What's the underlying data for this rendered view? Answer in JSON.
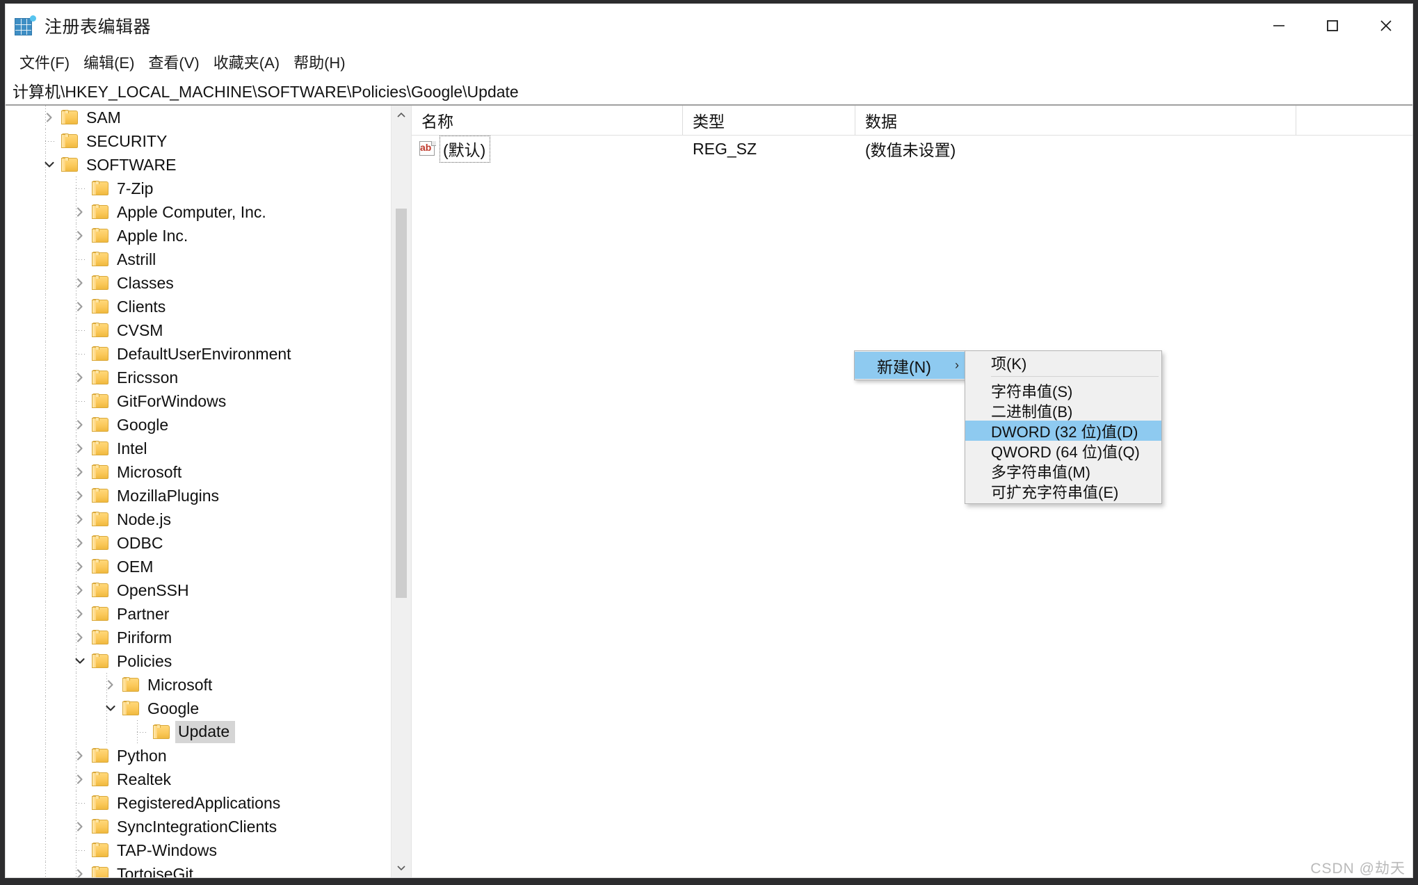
{
  "window": {
    "title": "注册表编辑器",
    "app_icon": "registry-editor-icon",
    "buttons": {
      "minimize": "minimize-icon",
      "maximize": "maximize-icon",
      "close": "close-icon"
    }
  },
  "menu_bar": {
    "items": [
      {
        "label": "文件(F)"
      },
      {
        "label": "编辑(E)"
      },
      {
        "label": "查看(V)"
      },
      {
        "label": "收藏夹(A)"
      },
      {
        "label": "帮助(H)"
      }
    ]
  },
  "address_bar": {
    "path": "计算机\\HKEY_LOCAL_MACHINE\\SOFTWARE\\Policies\\Google\\Update"
  },
  "tree": {
    "items": [
      {
        "label": "SAM",
        "depth": 1,
        "state": "collapsed",
        "selected": false
      },
      {
        "label": "SECURITY",
        "depth": 1,
        "state": "leaf",
        "selected": false
      },
      {
        "label": "SOFTWARE",
        "depth": 1,
        "state": "expanded",
        "selected": false
      },
      {
        "label": "7-Zip",
        "depth": 2,
        "state": "leaf",
        "selected": false
      },
      {
        "label": "Apple Computer, Inc.",
        "depth": 2,
        "state": "collapsed",
        "selected": false
      },
      {
        "label": "Apple Inc.",
        "depth": 2,
        "state": "collapsed",
        "selected": false
      },
      {
        "label": "Astrill",
        "depth": 2,
        "state": "leaf",
        "selected": false
      },
      {
        "label": "Classes",
        "depth": 2,
        "state": "collapsed",
        "selected": false
      },
      {
        "label": "Clients",
        "depth": 2,
        "state": "collapsed",
        "selected": false
      },
      {
        "label": "CVSM",
        "depth": 2,
        "state": "leaf",
        "selected": false
      },
      {
        "label": "DefaultUserEnvironment",
        "depth": 2,
        "state": "leaf",
        "selected": false
      },
      {
        "label": "Ericsson",
        "depth": 2,
        "state": "collapsed",
        "selected": false
      },
      {
        "label": "GitForWindows",
        "depth": 2,
        "state": "leaf",
        "selected": false
      },
      {
        "label": "Google",
        "depth": 2,
        "state": "collapsed",
        "selected": false
      },
      {
        "label": "Intel",
        "depth": 2,
        "state": "collapsed",
        "selected": false
      },
      {
        "label": "Microsoft",
        "depth": 2,
        "state": "collapsed",
        "selected": false
      },
      {
        "label": "MozillaPlugins",
        "depth": 2,
        "state": "collapsed",
        "selected": false
      },
      {
        "label": "Node.js",
        "depth": 2,
        "state": "collapsed",
        "selected": false
      },
      {
        "label": "ODBC",
        "depth": 2,
        "state": "collapsed",
        "selected": false
      },
      {
        "label": "OEM",
        "depth": 2,
        "state": "collapsed",
        "selected": false
      },
      {
        "label": "OpenSSH",
        "depth": 2,
        "state": "collapsed",
        "selected": false
      },
      {
        "label": "Partner",
        "depth": 2,
        "state": "collapsed",
        "selected": false
      },
      {
        "label": "Piriform",
        "depth": 2,
        "state": "collapsed",
        "selected": false
      },
      {
        "label": "Policies",
        "depth": 2,
        "state": "expanded",
        "selected": false
      },
      {
        "label": "Microsoft",
        "depth": 3,
        "state": "collapsed",
        "selected": false
      },
      {
        "label": "Google",
        "depth": 3,
        "state": "expanded",
        "selected": false
      },
      {
        "label": "Update",
        "depth": 4,
        "state": "leaf",
        "selected": true
      },
      {
        "label": "Python",
        "depth": 2,
        "state": "collapsed",
        "selected": false
      },
      {
        "label": "Realtek",
        "depth": 2,
        "state": "collapsed",
        "selected": false
      },
      {
        "label": "RegisteredApplications",
        "depth": 2,
        "state": "leaf",
        "selected": false
      },
      {
        "label": "SyncIntegrationClients",
        "depth": 2,
        "state": "collapsed",
        "selected": false
      },
      {
        "label": "TAP-Windows",
        "depth": 2,
        "state": "leaf",
        "selected": false
      },
      {
        "label": "TortoiseGit",
        "depth": 2,
        "state": "collapsed",
        "selected": false
      }
    ],
    "scrollbar": {
      "up_arrow": "chevron-up-icon",
      "down_arrow": "chevron-down-icon"
    }
  },
  "values": {
    "columns": [
      "名称",
      "类型",
      "数据"
    ],
    "rows": [
      {
        "icon": "string-value-icon",
        "name": "(默认)",
        "type": "REG_SZ",
        "data": "(数值未设置)",
        "focused": true
      }
    ]
  },
  "context_menu": {
    "parent": {
      "label": "新建(N)",
      "submenu_arrow": "chevron-right-icon",
      "highlighted": true
    },
    "submenu": {
      "items": [
        {
          "label": "项(K)",
          "highlighted": false,
          "separator_after": true
        },
        {
          "label": "字符串值(S)",
          "highlighted": false,
          "separator_after": false
        },
        {
          "label": "二进制值(B)",
          "highlighted": false,
          "separator_after": false
        },
        {
          "label": "DWORD (32 位)值(D)",
          "highlighted": true,
          "separator_after": false
        },
        {
          "label": "QWORD (64 位)值(Q)",
          "highlighted": false,
          "separator_after": false
        },
        {
          "label": "多字符串值(M)",
          "highlighted": false,
          "separator_after": false
        },
        {
          "label": "可扩充字符串值(E)",
          "highlighted": false,
          "separator_after": false
        }
      ]
    }
  },
  "watermark": {
    "text": "CSDN @劫天"
  },
  "colors": {
    "menu_highlight": "#8ecaf0",
    "tree_selection": "#d5d5d5",
    "folder": "#fbc95b",
    "menu_background": "#f0f0f0"
  }
}
